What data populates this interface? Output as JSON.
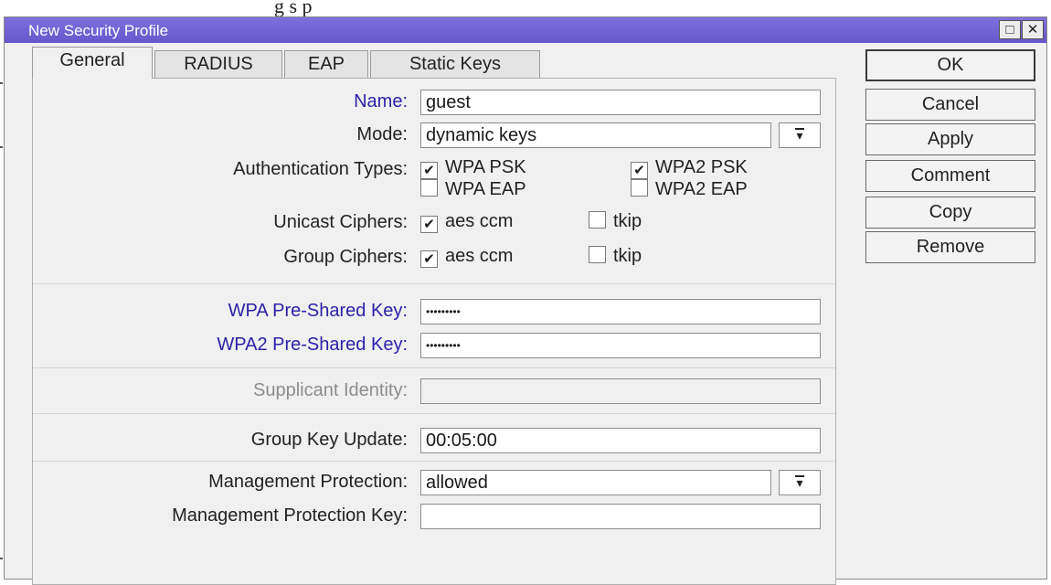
{
  "background": {
    "text_fragment": "g      s      p"
  },
  "window": {
    "title": "New Security Profile",
    "restore_glyph": "□",
    "close_glyph": "✕"
  },
  "tabs": [
    "General",
    "RADIUS",
    "EAP",
    "Static Keys"
  ],
  "form": {
    "name": {
      "label": "Name:",
      "value": "guest"
    },
    "mode": {
      "label": "Mode:",
      "value": "dynamic keys"
    },
    "auth_types": {
      "label": "Authentication Types:",
      "options": [
        {
          "label": "WPA PSK",
          "checked": true
        },
        {
          "label": "WPA2 PSK",
          "checked": true
        },
        {
          "label": "WPA EAP",
          "checked": false
        },
        {
          "label": "WPA2 EAP",
          "checked": false
        }
      ]
    },
    "unicast_ciphers": {
      "label": "Unicast Ciphers:",
      "options": [
        {
          "label": "aes ccm",
          "checked": true
        },
        {
          "label": "tkip",
          "checked": false
        }
      ]
    },
    "group_ciphers": {
      "label": "Group Ciphers:",
      "options": [
        {
          "label": "aes ccm",
          "checked": true
        },
        {
          "label": "tkip",
          "checked": false
        }
      ]
    },
    "wpa_psk": {
      "label": "WPA Pre-Shared Key:",
      "value": "•••••••••"
    },
    "wpa2_psk": {
      "label": "WPA2 Pre-Shared Key:",
      "value": "•••••••••"
    },
    "supplicant_identity": {
      "label": "Supplicant Identity:",
      "value": ""
    },
    "group_key_update": {
      "label": "Group Key Update:",
      "value": "00:05:00"
    },
    "management_protection": {
      "label": "Management Protection:",
      "value": "allowed"
    },
    "management_protection_key": {
      "label": "Management Protection Key:",
      "value": ""
    }
  },
  "buttons": [
    "OK",
    "Cancel",
    "Apply",
    "Comment",
    "Copy",
    "Remove"
  ],
  "icons": {
    "dropdown": "dropdown-arrow-icon",
    "check": "✔",
    "cursor": "text-cursor-icon"
  },
  "colors": {
    "titlebar": "#6f60d4",
    "highlight_label": "#2c22a8",
    "window_bg": "#f0f0f0"
  }
}
